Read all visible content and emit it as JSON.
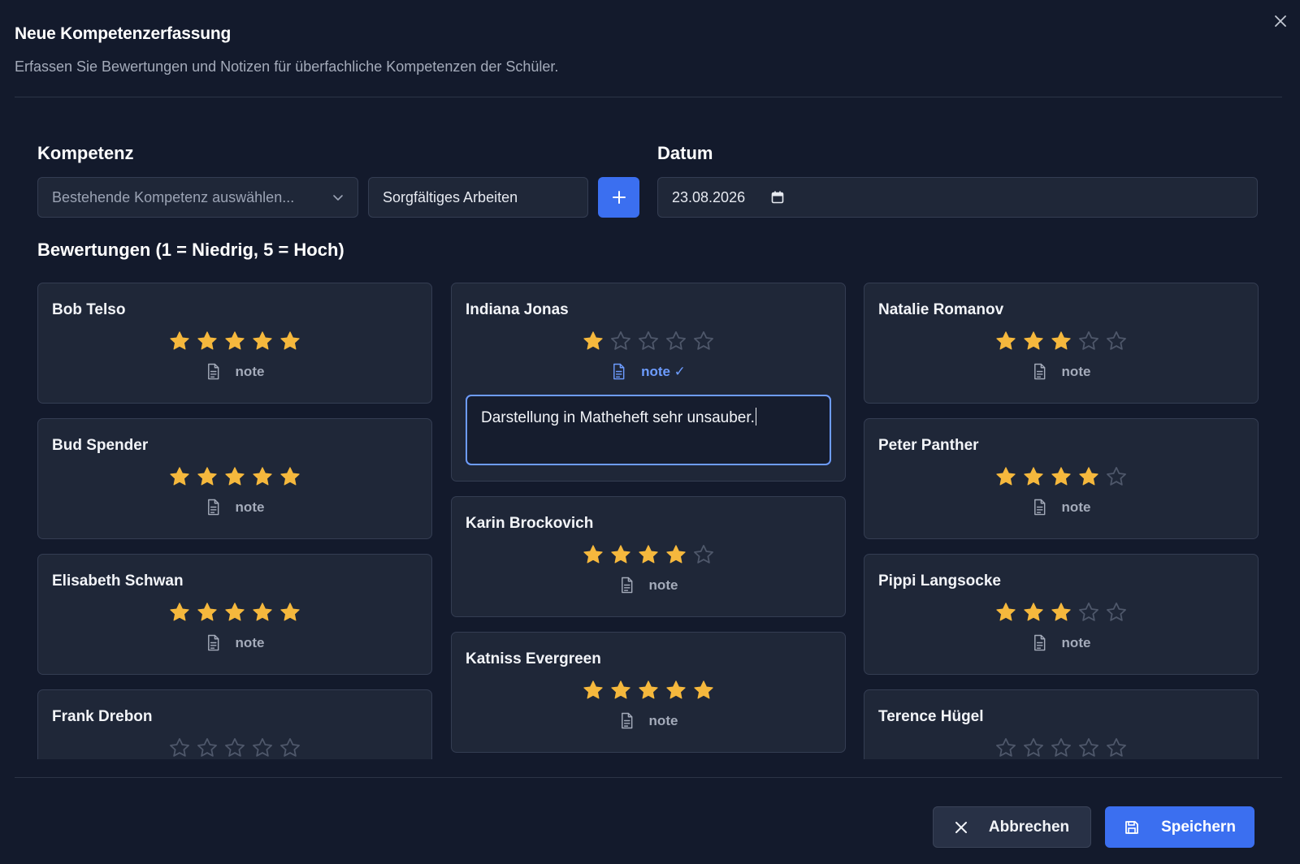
{
  "header": {
    "title": "Neue Kompetenzerfassung",
    "subtitle": "Erfassen Sie Bewertungen und Notizen für überfachliche Kompetenzen der Schüler."
  },
  "competence": {
    "label": "Kompetenz",
    "select_placeholder": "Bestehende Kompetenz auswählen...",
    "new_value": "Sorgfältiges Arbeiten"
  },
  "date": {
    "label": "Datum",
    "value": "23.08.2026"
  },
  "ratings": {
    "label": "Bewertungen (1 = Niedrig, 5 = Hoch)",
    "max": 5,
    "note_label": "note",
    "note_label_done": "note ✓",
    "columns": [
      [
        {
          "name": "Bob Telso",
          "rating": 5,
          "note": ""
        },
        {
          "name": "Bud Spender",
          "rating": 5,
          "note": ""
        },
        {
          "name": "Elisabeth Schwan",
          "rating": 5,
          "note": ""
        },
        {
          "name": "Frank Drebon",
          "rating": 0,
          "note": ""
        }
      ],
      [
        {
          "name": "Indiana Jonas",
          "rating": 1,
          "note": "Darstellung in Matheheft sehr unsauber.",
          "expanded": true
        },
        {
          "name": "Karin Brockovich",
          "rating": 4,
          "note": ""
        },
        {
          "name": "Katniss Evergreen",
          "rating": 5,
          "note": ""
        }
      ],
      [
        {
          "name": "Natalie Romanov",
          "rating": 3,
          "note": ""
        },
        {
          "name": "Peter Panther",
          "rating": 4,
          "note": ""
        },
        {
          "name": "Pippi Langsocke",
          "rating": 3,
          "note": ""
        },
        {
          "name": "Terence Hügel",
          "rating": 0,
          "note": ""
        }
      ]
    ]
  },
  "footer": {
    "cancel_label": "Abbrechen",
    "save_label": "Speichern"
  },
  "colors": {
    "background": "#131a2c",
    "card": "#1f2738",
    "accent": "#3b6ff0",
    "star_filled": "#f5b83d",
    "star_empty": "#4f586b"
  },
  "icons": {
    "close": "close-icon",
    "dropdown": "chevron-down-icon",
    "add": "plus-icon",
    "calendar": "calendar-icon",
    "note": "document-icon",
    "cancel": "x-icon",
    "save": "floppy-disk-icon"
  }
}
